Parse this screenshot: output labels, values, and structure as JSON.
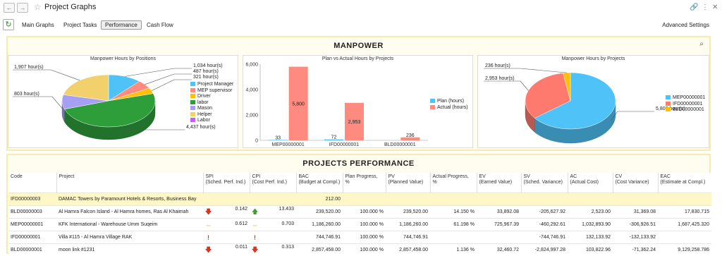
{
  "app": {
    "title": "Project Graphs"
  },
  "nav": {
    "back": "←",
    "forward": "→"
  },
  "tabs": [
    "Main Graphs",
    "Project Tasks",
    "Performance",
    "Cash Flow"
  ],
  "active_tab": "Performance",
  "advanced_settings": "Advanced Settings",
  "manpower": {
    "title": "MANPOWER"
  },
  "performance": {
    "title": "PROJECTS PERFORMANCE"
  },
  "colors": {
    "project_manager": "#4fc3f7",
    "mep_supervisor": "#ff8a80",
    "driver": "#ffc107",
    "labor_lower": "#2e9e3a",
    "mason": "#a59ff5",
    "helper": "#f2d06b",
    "labor_upper": "#c162f2",
    "plan": "#4fc3f7",
    "actual": "#ff8a80",
    "MEP00000001": "#4fc3f7",
    "IFD00000001": "#ff7a6e",
    "BLD00000001": "#ffc107"
  },
  "chart_data": [
    {
      "type": "pie",
      "title": "Manpower Hours by Positions",
      "slices": [
        {
          "label": "Project Manager",
          "value": 1034,
          "data_label": "1,034 hour(s)"
        },
        {
          "label": "MEP supervisor",
          "value": 487,
          "data_label": "487 hour(s)"
        },
        {
          "label": "Driver",
          "value": 321,
          "data_label": "321 hour(s)"
        },
        {
          "label": "labor",
          "value": 4437,
          "data_label": "4,437 hour(s)"
        },
        {
          "label": "Mason",
          "value": 803,
          "data_label": "803 hour(s)"
        },
        {
          "label": "Helper",
          "value": 1907,
          "data_label": "1,907 hour(s)"
        },
        {
          "label": "Labor",
          "value": 0,
          "data_label": ""
        }
      ]
    },
    {
      "type": "bar",
      "title": "Plan vs Actual Hours by Projects",
      "categories": [
        "MEP00000001",
        "IFD00000001",
        "BLD00000001"
      ],
      "series": [
        {
          "name": "Plan (hours)",
          "values": [
            33,
            72,
            0
          ],
          "labels": [
            "33",
            "72",
            ""
          ]
        },
        {
          "name": "Actual (hours)",
          "values": [
            5800,
            2953,
            236
          ],
          "labels": [
            "5,800",
            "2,953",
            "236"
          ]
        }
      ],
      "ylim": [
        0,
        6000
      ],
      "yticks": [
        "0",
        "2,000",
        "4,000",
        "6,000"
      ],
      "legend": "right",
      "grid": false
    },
    {
      "type": "pie",
      "title": "Manpower Hours by Projects",
      "slices": [
        {
          "label": "MEP00000001",
          "value": 5800,
          "data_label": "5,800 hour(s)"
        },
        {
          "label": "IFD00000001",
          "value": 2953,
          "data_label": "2,953 hour(s)"
        },
        {
          "label": "BLD00000001",
          "value": 236,
          "data_label": "236 hour(s)"
        }
      ]
    }
  ],
  "table": {
    "headers": [
      "Code",
      "Project",
      "SPI\n(Sched. Perf. Ind.)",
      "CPI\n(Cost Perf. Ind.)",
      "BAC\n(Budget at Compl.)",
      "Plan Progress,\n%",
      "PV\n(Planned Value)",
      "Actual Progress,\n%",
      "EV\n(Earned Value)",
      "SV\n(Sched. Variance)",
      "AC\n(Actual Cost)",
      "CV\n(Cost Variance)",
      "EAC\n(Estimate at Compl.)"
    ],
    "rows": [
      {
        "code": "IFD00000003",
        "project": "DAMAC Towers by Paramount Hotels & Resorts, Business Bay",
        "spi_icon": "",
        "spi": "",
        "cpi_icon": "",
        "cpi": "",
        "bac": "212.00",
        "plan": "",
        "pv": "",
        "actual": "",
        "ev": "",
        "sv": "",
        "ac": "",
        "cv": "",
        "eac": ""
      },
      {
        "code": "BLD00000003",
        "project": "Al Hamra Falcon Island - Al Hamra homes, Ras Al Khaimah",
        "spi_icon": "down-red",
        "spi": "0.142",
        "cpi_icon": "up-green",
        "cpi": "13.433",
        "bac": "239,520.00",
        "plan": "100.000 %",
        "pv": "239,520.00",
        "actual": "14.150 %",
        "ev": "33,892.08",
        "sv": "-205,627.92",
        "ac": "2,523.00",
        "cv": "31,369.08",
        "eac": "17,830.715"
      },
      {
        "code": "MEP00000001",
        "project": "KFK International - Warehouse Umm Suqeim",
        "spi_icon": "flat-yellow",
        "spi": "0.612",
        "cpi_icon": "flat-yellow",
        "cpi": "0.703",
        "bac": "1,186,260.00",
        "plan": "100.000 %",
        "pv": "1,186,260.00",
        "actual": "61.198 %",
        "ev": "725,967.39",
        "sv": "-460,292.61",
        "ac": "1,032,893.90",
        "cv": "-306,926.51",
        "eac": "1,687,425.320"
      },
      {
        "code": "IFD00000001",
        "project": "Villa #115 - Al Hamra Village RAK",
        "spi_icon": "alert-red",
        "spi": "",
        "cpi_icon": "alert-red",
        "cpi": "",
        "bac": "744,746.91",
        "plan": "100.000 %",
        "pv": "744,746.91",
        "actual": "",
        "ev": "",
        "sv": "-744,746.91",
        "ac": "132,133.92",
        "cv": "-132,133.92",
        "eac": ""
      },
      {
        "code": "BLD00000001",
        "project": "moon link #1231",
        "spi_icon": "down-red",
        "spi": "0.011",
        "cpi_icon": "down-red",
        "cpi": "0.313",
        "bac": "2,857,458.00",
        "plan": "100.000 %",
        "pv": "2,857,458.00",
        "actual": "1.136 %",
        "ev": "32,460.72",
        "sv": "-2,824,997.28",
        "ac": "103,822.96",
        "cv": "-71,362.24",
        "eac": "9,129,258.786"
      }
    ]
  }
}
